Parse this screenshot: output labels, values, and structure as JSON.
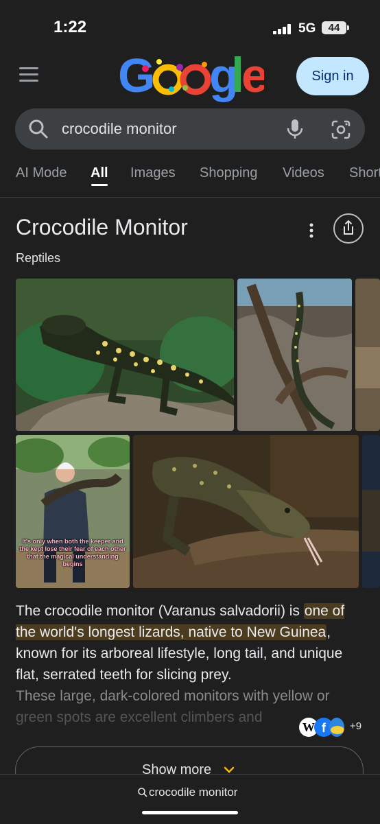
{
  "status": {
    "time": "1:22",
    "network": "5G",
    "battery": "44"
  },
  "header": {
    "logo_text": "Google",
    "sign_in": "Sign in"
  },
  "search": {
    "query": "crocodile monitor"
  },
  "tabs": [
    {
      "label": "AI Mode"
    },
    {
      "label": "All"
    },
    {
      "label": "Images"
    },
    {
      "label": "Shopping"
    },
    {
      "label": "Videos"
    },
    {
      "label": "Short"
    }
  ],
  "knowledge_panel": {
    "title": "Crocodile Monitor",
    "subtitle": "Reptiles",
    "image_caption": "It's only when both the keeper and the kept lose their fear of each other that the magical understanding begins",
    "desc_part1": "The crocodile monitor (Varanus salvadorii) is ",
    "desc_highlight": "one of the world's longest lizards, native to New Guinea",
    "desc_part2": ", known for its arboreal lifestyle, long tail, and unique flat, serrated teeth for slicing prey.",
    "desc_fade1": "These large, dark-colored monitors with yellow or",
    "desc_fade2": "green spots are excellent climbers and",
    "source_count": "+9",
    "show_more": "Show more"
  },
  "bottom": {
    "query": "crocodile monitor"
  },
  "colors": {
    "accent": "#c2e7ff",
    "background": "#1f1f1f",
    "highlight": "#4b3b1f"
  }
}
